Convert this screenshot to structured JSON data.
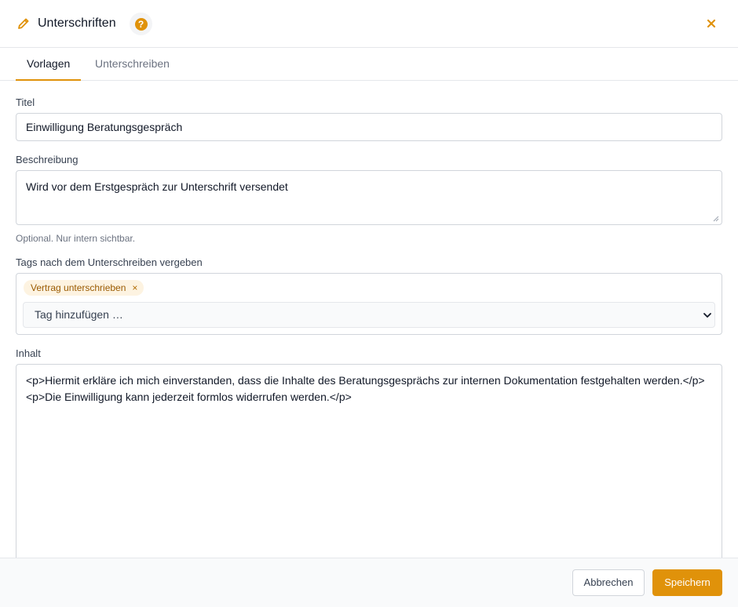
{
  "header": {
    "title": "Unterschriften",
    "help_symbol": "?",
    "icon": "pencil-icon",
    "accent_color": "#e0920a"
  },
  "tabs": [
    {
      "label": "Vorlagen",
      "active": true
    },
    {
      "label": "Unterschreiben",
      "active": false
    }
  ],
  "form": {
    "title_label": "Titel",
    "title_value": "Einwilligung Beratungsgespräch",
    "description_label": "Beschreibung",
    "description_value": "Wird vor dem Erstgespräch zur Unterschrift versendet",
    "description_hint": "Optional. Nur intern sichtbar.",
    "tags_label": "Tags nach dem Unterschreiben vergeben",
    "tags": [
      {
        "label": "Vertrag unterschrieben",
        "remove_symbol": "×"
      }
    ],
    "tag_select_placeholder": "Tag hinzufügen …",
    "content_label": "Inhalt",
    "content_lines": [
      "<p>Hiermit erkläre ich mich einverstanden, dass die Inhalte des Beratungsgesprächs zur internen Dokumentation festgehalten werden.</p>",
      "<p>Die Einwilligung kann jederzeit formlos widerrufen werden.</p>"
    ]
  },
  "footer": {
    "cancel_label": "Abbrechen",
    "save_label": "Speichern"
  }
}
